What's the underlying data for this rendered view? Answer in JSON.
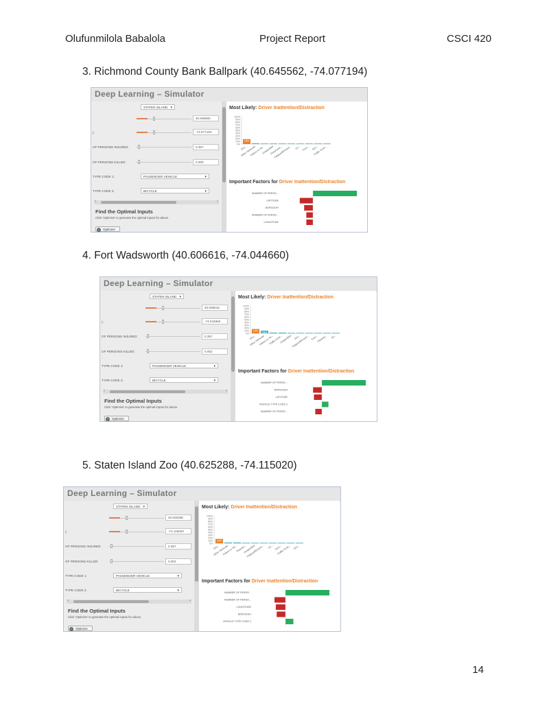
{
  "header": {
    "author": "Olufunmilola Babalola",
    "title": "Project Report",
    "course": "CSCI 420"
  },
  "page_number": "14",
  "simulator_common": {
    "title": "Deep Learning – Simulator",
    "borough_value": "STATEN ISLAND",
    "persons_injured_label": "OF PERSONS INJURED:",
    "persons_killed_label": "OF PERSONS KILLED:",
    "vtc1_label": "TYPE CODE 1:",
    "vtc2_label": "TYPE CODE 2:",
    "vtc1_value": "PASSENGER VEHICLE",
    "vtc2_value": "BICYCLE",
    "injured_value": "0.357",
    "killed_value": "0.002",
    "find_title": "Find the Optimal Inputs",
    "find_hint": "Click 'Optimize' to generate the optimal inputs for above.",
    "optimize_label": "Optimize",
    "most_likely_label": "Most Likely:",
    "important_label": "Important Factors for",
    "predicted": "Driver Inattention/Distraction",
    "y_ticks": [
      "100%",
      "90%",
      "80%",
      "70%",
      "60%",
      "50%",
      "40%",
      "30%",
      "20%",
      "10%",
      "0%"
    ],
    "orange": "#e8832b",
    "teal": "#4fb3bf",
    "green": "#27ae60",
    "red": "#c62828"
  },
  "sections": [
    {
      "caption": "3.   Richmond County Bank Ballpark (40.645562, -74.077194)",
      "lat_value": "40.645562",
      "lon_value": "-74.077194",
      "killed_value": "0.000",
      "chart_data": [
        {
          "type": "bar",
          "title": "Most Likely: Driver Inattention/Distraction",
          "categories": [
            "Driv...",
            "Other Vehicular",
            "Failure to Yie...",
            "Unspecified",
            "Pass/Lane...",
            "Fatigued/Drowsi...",
            "Un...",
            "Turni...",
            "Driv...",
            "Traffic Contr..."
          ],
          "values": [
            18,
            3,
            2,
            2,
            2,
            2,
            2,
            2,
            2,
            2
          ],
          "bar_label": "18%",
          "ylim": [
            0,
            100
          ]
        },
        {
          "type": "bar",
          "orientation": "horizontal",
          "title": "Important Factors for Driver Inattention/Distraction",
          "categories": [
            "NUMBER OF PERSO...",
            "LATITUDE",
            "BOROUGH",
            "NUMBER OF PERSO...",
            "LONGITUDE"
          ],
          "values": [
            1.0,
            -0.3,
            -0.2,
            -0.15,
            -0.15
          ]
        }
      ]
    },
    {
      "caption": "4.   Fort Wadsworth (40.606616, -74.044660)",
      "lat_value": "40.606616",
      "lon_value": "-74.044660",
      "killed_value": "0.002",
      "chart_data": [
        {
          "type": "bar",
          "title": "Most Likely: Driver Inattention/Distraction",
          "categories": [
            "Driv...",
            "Other Vehicular",
            "Failure to Yie...",
            "Traffic Contr...",
            "Unspecified",
            "Driv...",
            "Fatigued/Drowsi...",
            "Turni...",
            "Passing...",
            "Ot..."
          ],
          "values": [
            16,
            10,
            3,
            3,
            2,
            2,
            2,
            2,
            2,
            2
          ],
          "bar_label": "16%",
          "bar_label_2": "10%",
          "ylim": [
            0,
            100
          ]
        },
        {
          "type": "bar",
          "orientation": "horizontal",
          "title": "Important Factors for Driver Inattention/Distraction",
          "categories": [
            "NUMBER OF PERSO...",
            "BOROUGH",
            "LATITUDE",
            "VEHICLE TYPE CODE 2",
            "NUMBER OF PERSO..."
          ],
          "values": [
            1.0,
            -0.2,
            -0.18,
            0.15,
            -0.15
          ]
        }
      ]
    },
    {
      "caption": "5.   Staten Island Zoo (40.625288, -74.115020)",
      "lat_value": "40.625288",
      "lon_value": "-74.115020",
      "killed_value": "0.002",
      "chart_data": [
        {
          "type": "bar",
          "title": "Most Likely: Driver Inattention/Distraction",
          "categories": [
            "Driv...",
            "Other Vehicular",
            "Failure to Yie...",
            "Passing...",
            "Unspecified",
            "Fatigued/Drowsi...",
            "Ot...",
            "Turni...",
            "Traffic Contr...",
            "Driv..."
          ],
          "values": [
            16,
            3,
            3,
            2,
            2,
            2,
            2,
            2,
            2,
            2
          ],
          "bar_label": "16%",
          "ylim": [
            0,
            100
          ]
        },
        {
          "type": "bar",
          "orientation": "horizontal",
          "title": "Important Factors for Driver Inattention/Distraction",
          "categories": [
            "NUMBER OF PERSO...",
            "NUMBER OF PERSO...",
            "LONGITUDE",
            "BOROUGH",
            "VEHICLE TYPE CODE 2"
          ],
          "values": [
            1.0,
            -0.25,
            -0.22,
            -0.2,
            0.18
          ]
        }
      ]
    }
  ]
}
